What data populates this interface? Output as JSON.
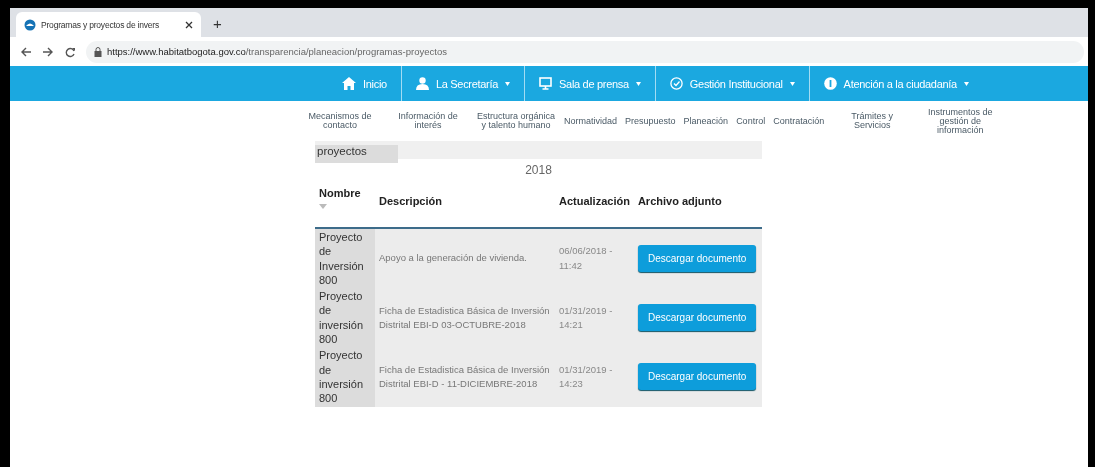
{
  "browser": {
    "tab_title": "Programas y proyectos de invers",
    "new_tab": "+",
    "url_host": "https://www.habitatbogota.gov.co",
    "url_path": "/transparencia/planeacion/programas-proyectos"
  },
  "main_nav": [
    {
      "label": "Inicio",
      "dropdown": false
    },
    {
      "label": "La Secretaría",
      "dropdown": true
    },
    {
      "label": "Sala de prensa",
      "dropdown": true
    },
    {
      "label": "Gestión Institucional",
      "dropdown": true
    },
    {
      "label": "Atención a la ciudadanía",
      "dropdown": true
    }
  ],
  "sub_nav": [
    "Mecanismos de contacto",
    "Información de interés",
    "Estructura orgánica y talento humano",
    "Normatividad",
    "Presupuesto",
    "Planeación",
    "Control",
    "Contratación",
    "Trámites y Servicios",
    "Instrumentos de gestión de información"
  ],
  "section_label": "proyectos",
  "year": "2018",
  "table": {
    "columns": [
      "Nombre",
      "Descripción",
      "Actualización",
      "Archivo adjunto"
    ],
    "rows": [
      {
        "name": "Proyecto de Inversión 800",
        "description": "Apoyo a la generación de vivienda.",
        "updated": "06/06/2018 - 11:42",
        "button": "Descargar documento"
      },
      {
        "name": "Proyecto de inversión 800",
        "description": "Ficha de Estadistica Básica de Inversión Distrital EBI-D 03-OCTUBRE-2018",
        "updated": "01/31/2019 - 14:21",
        "button": "Descargar documento"
      },
      {
        "name": "Proyecto de inversión 800",
        "description": "Ficha de Estadistica Básica de Inversión Distrital EBI-D - 11-DICIEMBRE-2018",
        "updated": "01/31/2019 - 14:23",
        "button": "Descargar documento"
      }
    ]
  }
}
